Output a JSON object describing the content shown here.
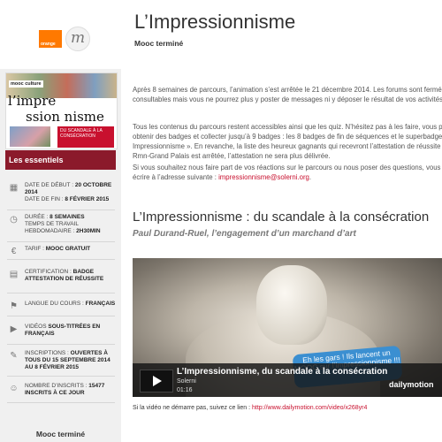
{
  "header": {
    "brand_label": "orange",
    "logo_letter": "m",
    "title": "L’Impressionnisme",
    "subtitle": "Mooc terminé"
  },
  "sidebar": {
    "hero": {
      "badge": "mooc culture",
      "title_line1": "l’impre",
      "title_line2": "ssion nisme",
      "red_caption": "DU SCANDALE À LA CONSÉCRATION"
    },
    "essentials_title": "Les essentiels",
    "items": [
      {
        "icon": "calendar-icon",
        "glyph": "▦",
        "text": "Date de début : ",
        "bold": "20 octobre 2014",
        "text2": "Date de fin : ",
        "bold2": "8 février 2015"
      },
      {
        "icon": "clock-icon",
        "glyph": "◷",
        "text": "Durée : ",
        "bold": "8 semaines",
        "text2": "Temps de travail hebdomadaire : ",
        "bold2": "2h30min"
      },
      {
        "icon": "euro-icon",
        "glyph": "€",
        "text": "Tarif : ",
        "bold": "MOOC gratuit",
        "text2": "",
        "bold2": ""
      },
      {
        "icon": "certificate-icon",
        "glyph": "▤",
        "text": "Certification : ",
        "bold": "Badge Attestation de réussite",
        "text2": "",
        "bold2": ""
      },
      {
        "icon": "flag-icon",
        "glyph": "⚑",
        "text": "Langue du cours : ",
        "bold": "Français",
        "text2": "",
        "bold2": ""
      },
      {
        "icon": "video-icon",
        "glyph": "▶",
        "text": "Vidéos ",
        "bold": "sous-titrées en français",
        "text2": "",
        "bold2": ""
      },
      {
        "icon": "pencil-icon",
        "glyph": "✎",
        "text": "Inscriptions : ",
        "bold": "ouvertes à tous du 15 septembre 2014 au 8 février 2015",
        "text2": "",
        "bold2": ""
      },
      {
        "icon": "people-icon",
        "glyph": "☺",
        "text": "Nombre d’inscrits : ",
        "bold": "15477 inscrits à ce jour",
        "text2": "",
        "bold2": ""
      }
    ],
    "status": "Mooc terminé"
  },
  "main": {
    "p1": "Après 8 semaines de parcours, l’animation s’est arrêtée le 21 décembre 2014. Les forums sont fermés ; ils restent consultables mais vous ne pourrez plus y poster de messages ni y déposer le résultat de vos activités.",
    "p2": "Tous les contenus du parcours restent accessibles ainsi que les quiz. N’hésitez pas à les faire, vous pouvez encore obtenir des badges et collecter jusqu’à 9 badges : les 8 badges de fin de séquences et le superbadge « Impressionnisme ». En revanche, la liste des heureux gagnants qui recevront l’attestation de réussite délivrée par la Rmn-Grand Palais est arrêtée, l’attestation ne sera plus délivrée.",
    "p3": "Si vous souhaitez nous faire part de vos réactions sur le parcours ou nous poser des questions, vous pouvez nous écrire à l’adresse suivante : ",
    "email": "impressionnisme@solerni.org",
    "p3_end": ".",
    "section_title": "L’Impressionnisme : du scandale à la consécration",
    "section_subtitle": "Paul Durand-Ruel, l’engagement d’un marchand d’art",
    "video": {
      "bubble": "Eh les gars ! Ils lancent un MOOC sur l’impressionnisme !!!",
      "title": "L’Impressionnisme, du scandale à la consécration",
      "channel": "Solerni",
      "duration": "01:16",
      "brand": "dailymotion"
    },
    "caption_text": "Si la vidéo ne démarre pas, suivez ce lien : ",
    "caption_link": "http://www.dailymotion.com/video/x268yr4"
  }
}
